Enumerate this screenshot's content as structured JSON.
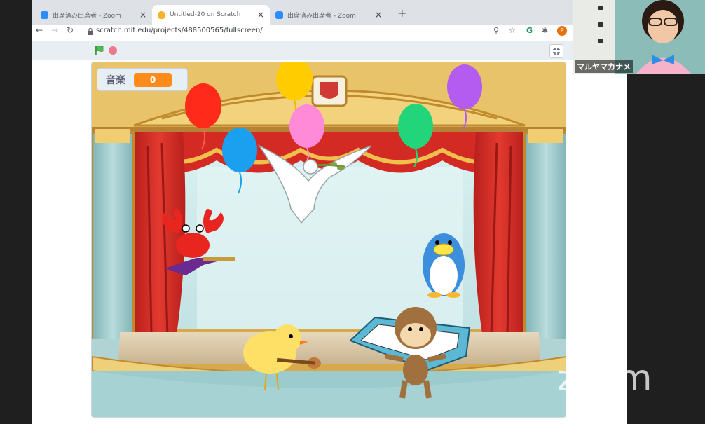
{
  "browser": {
    "tabs": [
      {
        "title": "出席済み出席者 - Zoom",
        "icon": "zoom-favicon",
        "active": false
      },
      {
        "title": "Untitled-20 on Scratch",
        "icon": "scratch-favicon",
        "active": true
      },
      {
        "title": "出席済み出席者 - Zoom",
        "icon": "zoom-favicon",
        "active": false
      }
    ],
    "new_tab": "+",
    "close_glyph": "×",
    "url": "scratch.mit.edu/projects/488500565/fullscreen/",
    "profile_initial": "P"
  },
  "scratch": {
    "monitor_label": "音楽",
    "monitor_value": "0"
  },
  "webcam": {
    "participant_name": "マルヤマカナメ"
  },
  "watermark": "zoom",
  "colors": {
    "stage_curtain": "#d62d27",
    "stage_gold": "#e8b94a",
    "monitor_value_bg": "#ff8c1a",
    "green_flag": "#4cae4c"
  },
  "balloons": [
    {
      "color": "#ff2a1a",
      "name": "red"
    },
    {
      "color": "#ffcc00",
      "name": "yellow"
    },
    {
      "color": "#ff8ad8",
      "name": "pink"
    },
    {
      "color": "#1ba0f0",
      "name": "blue"
    },
    {
      "color": "#22d47a",
      "name": "green"
    },
    {
      "color": "#b45cf0",
      "name": "purple"
    }
  ]
}
